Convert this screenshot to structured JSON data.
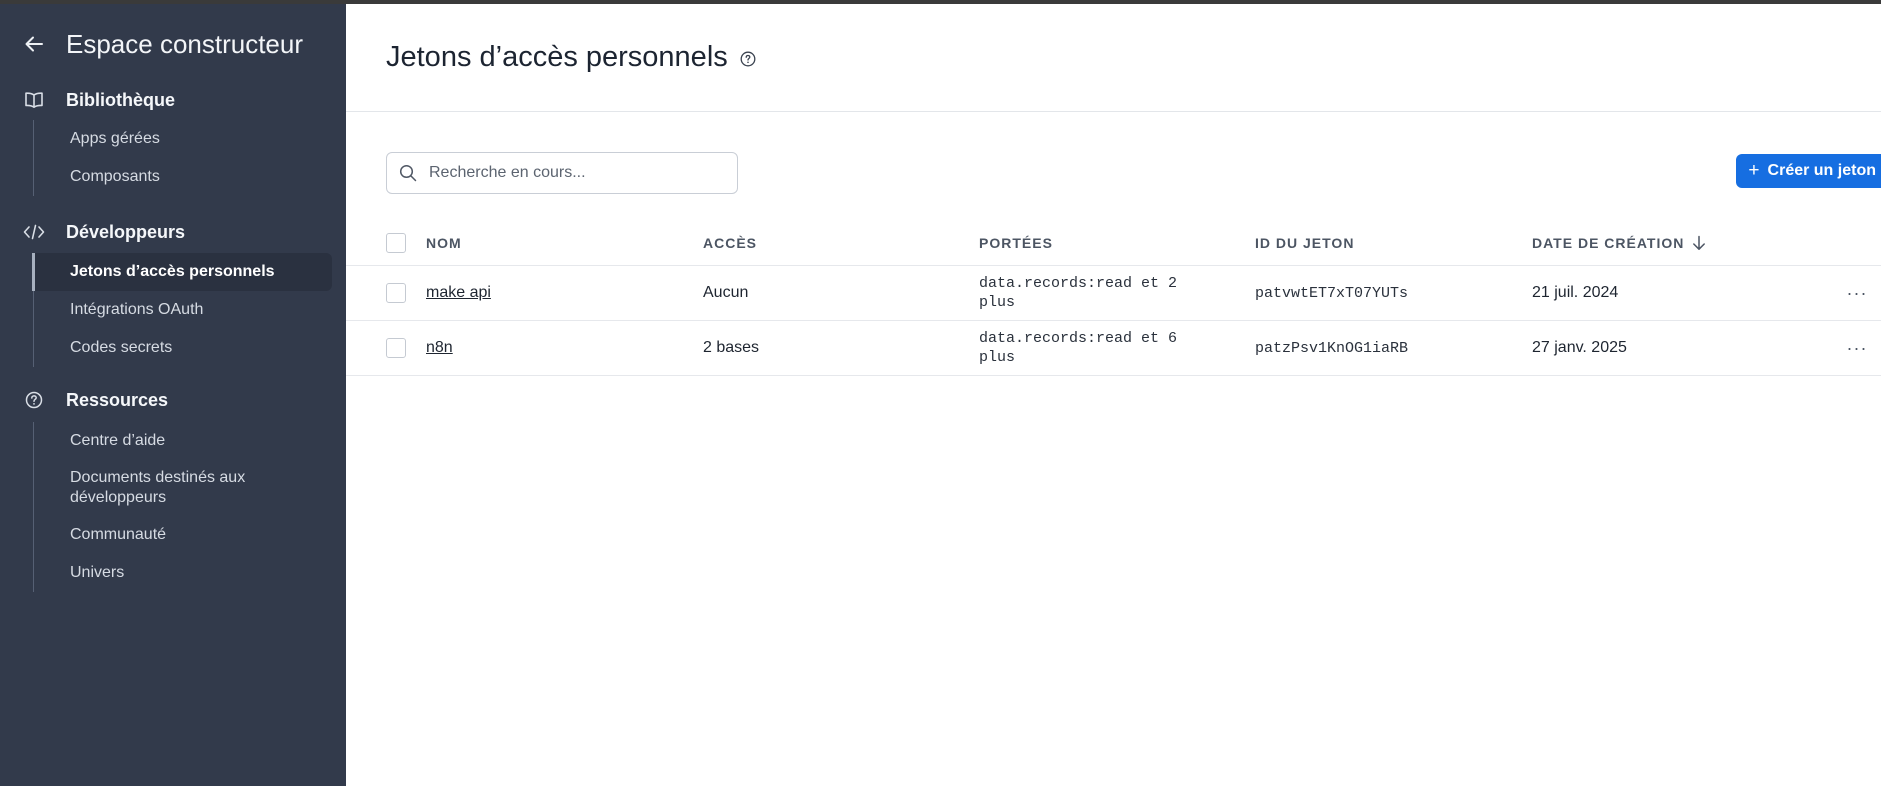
{
  "sidebar": {
    "title": "Espace constructeur",
    "sections": [
      {
        "label": "Bibliothèque",
        "icon": "book-icon",
        "items": [
          {
            "label": "Apps gérées"
          },
          {
            "label": "Composants"
          }
        ]
      },
      {
        "label": "Développeurs",
        "icon": "code-icon",
        "items": [
          {
            "label": "Jetons d’accès personnels",
            "active": true
          },
          {
            "label": "Intégrations OAuth"
          },
          {
            "label": "Codes secrets"
          }
        ]
      },
      {
        "label": "Ressources",
        "icon": "help-circle-icon",
        "items": [
          {
            "label": "Centre d’aide"
          },
          {
            "label": "Documents destinés aux développeurs"
          },
          {
            "label": "Communauté"
          },
          {
            "label": "Univers"
          }
        ]
      }
    ]
  },
  "main": {
    "title": "Jetons d’accès personnels",
    "search": {
      "placeholder": "Recherche en cours...",
      "value": ""
    },
    "create_button": "Créer un jeton",
    "table": {
      "headers": {
        "name": "NOM",
        "access": "ACCÈS",
        "scopes": "PORTÉES",
        "token_id": "ID DU JETON",
        "created": "DATE DE CRÉATION"
      },
      "rows": [
        {
          "name": "make api",
          "access": "Aucun",
          "scopes": "data.records:read et 2 plus",
          "token_id": "patvwtET7xT07YUTs",
          "created": "21 juil. 2024"
        },
        {
          "name": "n8n",
          "access": "2 bases",
          "scopes": "data.records:read et 6 plus",
          "token_id": "patzPsv1KnOG1iaRB",
          "created": "27 janv. 2025"
        }
      ],
      "more_label": "···"
    }
  },
  "colors": {
    "sidebar_bg": "#323a4b",
    "accent": "#166ee1"
  }
}
